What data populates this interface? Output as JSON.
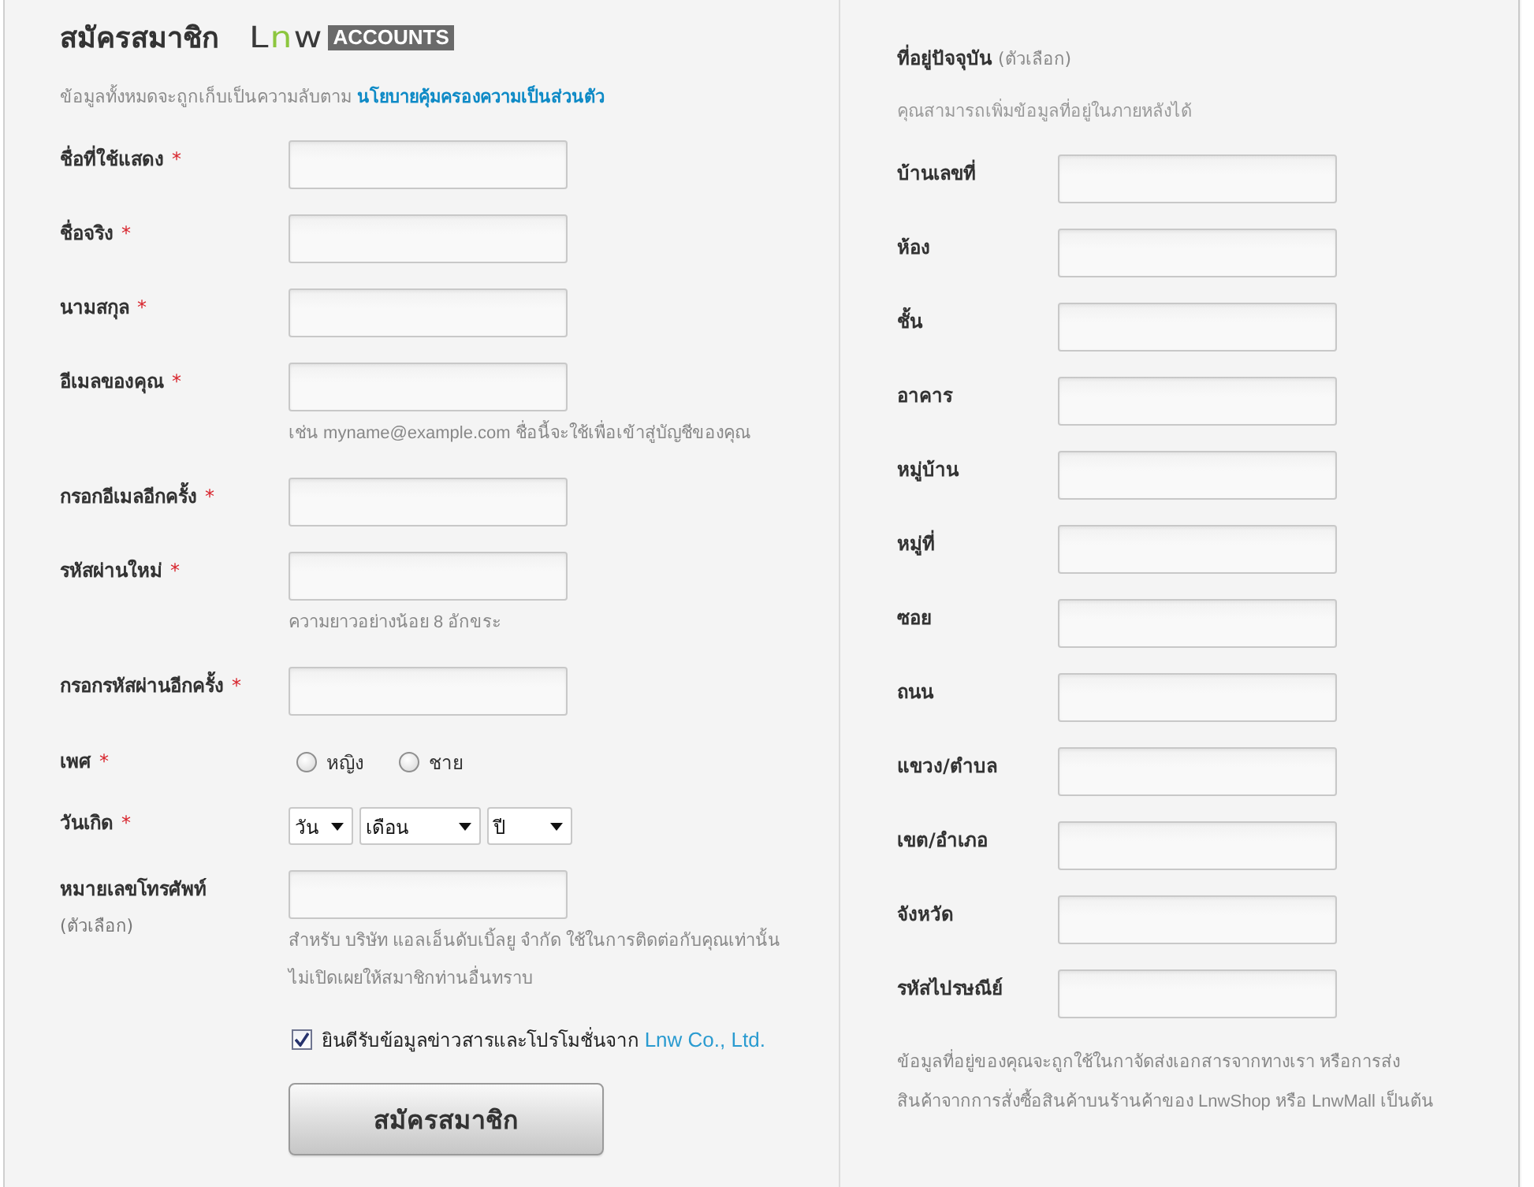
{
  "signup": {
    "title": "สมัครสมาชิก",
    "logo": {
      "wordmark": "Lnw",
      "badge": "ACCOUNTS"
    },
    "privacy_note": {
      "text": "ข้อมูลทั้งหมดจะถูกเก็บเป็นความลับตาม ",
      "link": "นโยบายคุ้มครองความเป็นส่วนตัว"
    },
    "fields": [
      {
        "kind": "text",
        "label": "ชื่อที่ใช้แสดง",
        "required_mark": "*"
      },
      {
        "kind": "text",
        "label": "ชื่อจริง",
        "required_mark": "*"
      },
      {
        "kind": "text",
        "label": "นามสกุล",
        "required_mark": "*"
      },
      {
        "kind": "text",
        "label": "อีเมลของคุณ",
        "required_mark": "*",
        "hints": [
          "เช่น myname@example.com ชื่อนี้จะใช้เพื่อเข้าสู่บัญชีของคุณ"
        ]
      },
      {
        "kind": "text",
        "label": "กรอกอีเมลอีกครั้ง",
        "required_mark": "*"
      },
      {
        "kind": "text",
        "label": "รหัสผ่านใหม่",
        "required_mark": "*",
        "hints": [
          "ความยาวอย่างน้อย 8 อักขระ"
        ]
      },
      {
        "kind": "text",
        "label": "กรอกรหัสผ่านอีกครั้ง",
        "required_mark": "*"
      },
      {
        "kind": "radio",
        "label": "เพศ",
        "required_mark": "*",
        "options": [
          {
            "label": "หญิง",
            "selected": false
          },
          {
            "label": "ชาย",
            "selected": false
          }
        ]
      },
      {
        "kind": "date",
        "label": "วันเกิด",
        "required_mark": "*",
        "selects": [
          {
            "value": "วัน"
          },
          {
            "value": "เดือน"
          },
          {
            "value": "ปี"
          }
        ]
      },
      {
        "kind": "text",
        "label": "หมายเลขโทรศัพท์",
        "note": "(ตัวเลือก)",
        "hints": [
          "สำหรับ บริษัท แอลเอ็นดับเบิ้ลยู จำกัด ใช้ในการติดต่อกับคุณเท่านั้น",
          "ไม่เปิดเผยให้สมาชิกท่านอื่นทราบ"
        ]
      }
    ],
    "newsletter": {
      "checked": true,
      "text": "ยินดีรับข้อมูลข่าวสารและโปรโมชั่นจาก ",
      "link": "Lnw Co., Ltd."
    },
    "submit_button": "สมัครสมาชิก"
  },
  "address": {
    "title": "ที่อยู่ปัจจุบัน",
    "note": "(ตัวเลือก)",
    "subtitle": "คุณสามารถเพิ่มข้อมูลที่อยู่ในภายหลังได้",
    "fields": [
      {
        "kind": "text",
        "label": "บ้านเลขที่"
      },
      {
        "kind": "text",
        "label": "ห้อง"
      },
      {
        "kind": "text",
        "label": "ชั้น"
      },
      {
        "kind": "text",
        "label": "อาคาร"
      },
      {
        "kind": "text",
        "label": "หมู่บ้าน"
      },
      {
        "kind": "text",
        "label": "หมู่ที่"
      },
      {
        "kind": "text",
        "label": "ซอย"
      },
      {
        "kind": "text",
        "label": "ถนน"
      },
      {
        "kind": "text",
        "label": "แขวง/ตำบล"
      },
      {
        "kind": "text",
        "label": "เขต/อำเภอ"
      },
      {
        "kind": "text",
        "label": "จังหวัด"
      },
      {
        "kind": "text",
        "label": "รหัสไปรษณีย์"
      }
    ],
    "footer": [
      "ข้อมูลที่อยู่ของคุณจะถูกใช้ในกาจัดส่งเอกสารจากทางเรา หรือการส่ง",
      "สินค้าจากการสั่งซื้อสินค้าบนร้านค้าของ LnwShop หรือ LnwMall เป็นต้น"
    ]
  }
}
